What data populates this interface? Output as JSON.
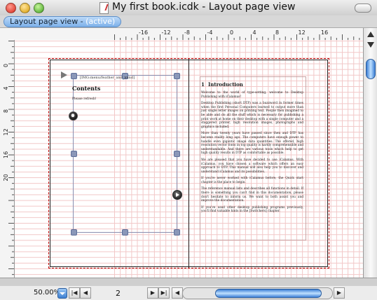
{
  "window": {
    "title": "My first book.icdk - Layout page view"
  },
  "tab": {
    "label": "Layout page view - ",
    "status": "(active)"
  },
  "rulers": {
    "horizontal_labels": [
      "-16",
      "-12",
      "-8",
      "-4",
      "0",
      "4",
      "8",
      "12",
      "16"
    ],
    "vertical_labels": [
      "0",
      "4",
      "8",
      "12",
      "16",
      "20"
    ]
  },
  "page_left": {
    "image_placeholder": "[IMG:menu/feather_and_mind]",
    "contents_heading": "Contents",
    "refresh_note": "Please refresh!"
  },
  "page_right": {
    "chapter_number": "1",
    "chapter_title": "Introduction",
    "paragraphs": [
      "Welcome to the world of type-setting, welcome to Desktop Publishing with iCalamus!",
      "Desktop Publishing (short DTP) was a buzzword in former times when the first Personal Computers learned to output more than just single letter images on printing text. People then imagined to be able and do all the stuff which is necessary for publishing a print work at home on their desktop with a single computer and a staggered printer, high resolution images, photographs and graphics included.",
      "More than twenty years have passed since then and DTP has become reality long ago. The computers have enough power to handle even gigantic image data quantities. The offered, high resolution vector fonts in top quality is hardly comprehensible and understandable. And there are various tools which help to get high quality results in DTP as comfortable as possible.",
      "We are pleased that you have decided to use iCalamus. With iCalamus, you have chosen a software which offers an easy approach to DTP. This manual will also help you to discover and understand iCalamus and its possibilities.",
      "If you're never worked with iCalamus before, the Quick start chapter is the place to begin.",
      "The reference manual lists and describes all functions in detail. If there is something you can't find in this documentation, please don't hesitate to inform us. We want to both assist you and improve the documentation.",
      "If you've used other desktop publishing programs previously, you'll find valuable hints in the [Switchers] chapter."
    ]
  },
  "statusbar": {
    "zoom": "50.00%",
    "first_page": "|◀",
    "prev_page": "◀",
    "page_number": "2",
    "next_page": "▶",
    "last_page": "▶|",
    "scroll_left": "◀",
    "scroll_right": "▶"
  },
  "colors": {
    "accent": "#3c7fd6",
    "grid": "#f2c8c8",
    "bleed_border": "#bb0000"
  }
}
